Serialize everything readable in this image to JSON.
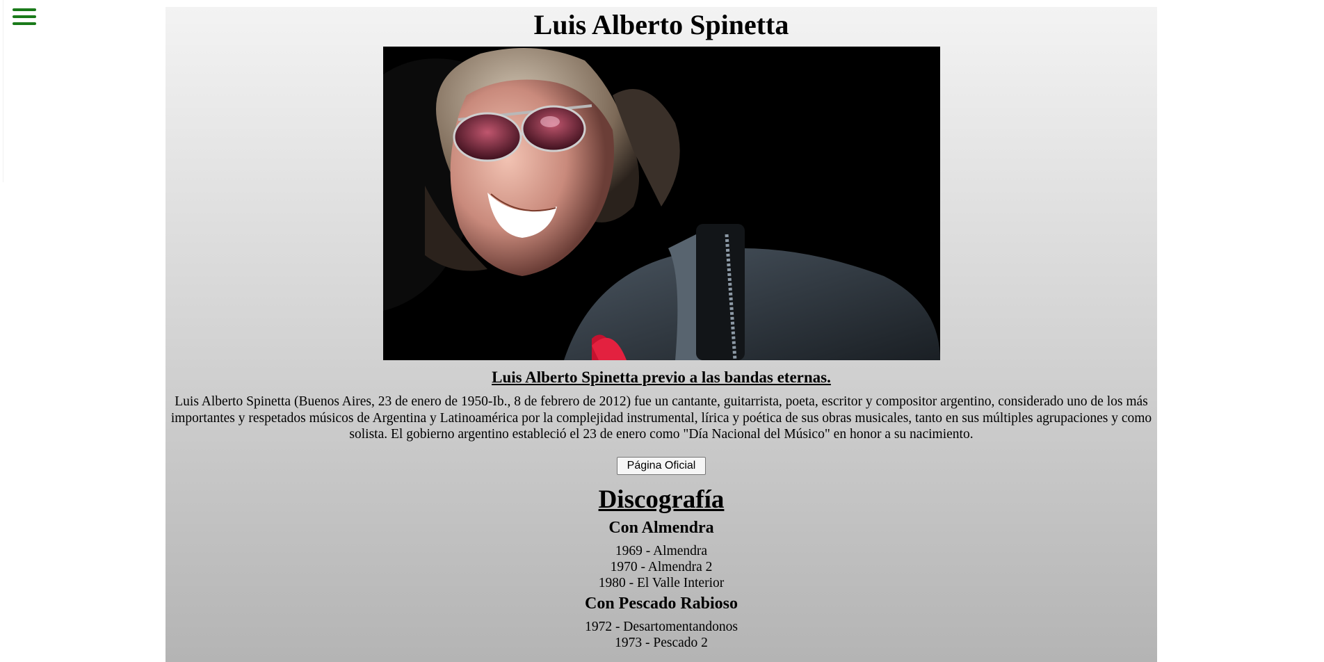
{
  "colors": {
    "menu_icon": "#1a7a1a",
    "background": "#ffffff",
    "container_top": "#f3f3f3",
    "container_bottom": "#b4b4b4"
  },
  "menu": {
    "icon": "hamburger-menu-icon"
  },
  "page": {
    "title": "Luis Alberto Spinetta",
    "caption": "Luis Alberto Spinetta previo a las bandas eternas.",
    "bio": "Luis Alberto Spinetta (Buenos Aires, 23 de enero de 1950-Ib., 8 de febrero de 2012) fue un cantante, guitarrista, poeta, escritor y compositor argentino, considerado uno de los más importantes y respetados músicos de Argentina y Latinoamérica por la complejidad instrumental, lírica y poética de sus obras musicales, tanto en sus múltiples agrupaciones y como solista. El gobierno argentino estableció el 23 de enero como \"Día Nacional del Músico\" en honor a su nacimiento.",
    "official_button": "Página Oficial"
  },
  "discography": {
    "title": "Discografía",
    "groups": [
      {
        "name": "Con Almendra",
        "albums": [
          "1969 - Almendra",
          "1970 - Almendra 2",
          "1980 - El Valle Interior"
        ]
      },
      {
        "name": "Con Pescado Rabioso",
        "albums": [
          "1972 - Desartomentandonos",
          "1973 - Pescado 2"
        ]
      }
    ]
  }
}
